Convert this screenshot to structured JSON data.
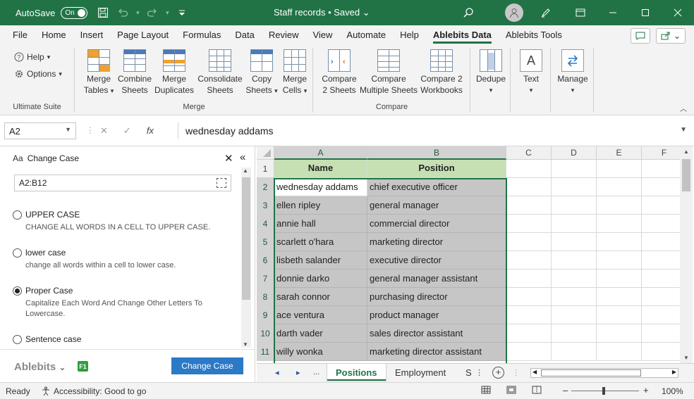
{
  "titlebar": {
    "autosave_label": "AutoSave",
    "autosave_state": "On",
    "title": "Staff records • Saved",
    "title_chevron": "⌄",
    "icons": [
      "save-icon",
      "undo-icon",
      "redo-icon",
      "customize-icon",
      "search-icon",
      "avatar",
      "pen-icon",
      "ribbon-display-icon",
      "minimize-icon",
      "maximize-icon",
      "close-icon"
    ]
  },
  "menu": {
    "tabs": [
      "File",
      "Home",
      "Insert",
      "Page Layout",
      "Formulas",
      "Data",
      "Review",
      "View",
      "Automate",
      "Help",
      "Ablebits Data",
      "Ablebits Tools"
    ],
    "active": "Ablebits Data",
    "share_arrow": "⌄"
  },
  "ribbon": {
    "ultimate_suite": {
      "label": "Ultimate Suite",
      "help": "Help",
      "options": "Options"
    },
    "merge": {
      "label": "Merge",
      "buttons": [
        {
          "line1": "Merge",
          "line2": "Tables"
        },
        {
          "line1": "Combine",
          "line2": "Sheets"
        },
        {
          "line1": "Merge",
          "line2": "Duplicates"
        },
        {
          "line1": "Consolidate",
          "line2": "Sheets"
        },
        {
          "line1": "Copy",
          "line2": "Sheets"
        },
        {
          "line1": "Merge",
          "line2": "Cells"
        }
      ]
    },
    "compare": {
      "label": "Compare",
      "buttons": [
        {
          "line1": "Compare",
          "line2": "2 Sheets"
        },
        {
          "line1": "Compare",
          "line2": "Multiple Sheets"
        },
        {
          "line1": "Compare 2",
          "line2": "Workbooks"
        }
      ]
    },
    "dedupe": {
      "label": "Dedupe"
    },
    "text": {
      "label": "Text",
      "glyph": "A"
    },
    "manage": {
      "label": "Manage"
    }
  },
  "formula_bar": {
    "name_box": "A2",
    "cancel": "✕",
    "enter": "✓",
    "fx": "fx",
    "value": "wednesday addams"
  },
  "pane": {
    "icon_glyph": "Aa",
    "title": "Change Case",
    "close": "✕",
    "collapse": "«",
    "range": "A2:B12",
    "options": [
      {
        "label": "UPPER CASE",
        "desc": "CHANGE ALL WORDS IN A CELL TO UPPER CASE.",
        "checked": false
      },
      {
        "label": "lower case",
        "desc": "change all words within a cell to lower case.",
        "checked": false
      },
      {
        "label": "Proper Case",
        "desc": "Capitalize Each Word And Change Other Letters To Lowercase.",
        "checked": true
      },
      {
        "label": "Sentence case",
        "desc": "",
        "checked": false
      }
    ],
    "brand": "Ablebits",
    "brand_chevron": "⌄",
    "f1": "F1",
    "primary_button": "Change Case"
  },
  "sheet": {
    "columns": [
      "A",
      "B",
      "C",
      "D",
      "E",
      "F"
    ],
    "rows": [
      "1",
      "2",
      "3",
      "4",
      "5",
      "6",
      "7",
      "8",
      "9",
      "10",
      "11"
    ],
    "headers": [
      "Name",
      "Position"
    ],
    "data": [
      [
        "wednesday addams",
        "chief executive officer"
      ],
      [
        "ellen ripley",
        "general manager"
      ],
      [
        "annie hall",
        "commercial director"
      ],
      [
        "scarlett o'hara",
        "marketing director"
      ],
      [
        "lisbeth salander",
        "executive director"
      ],
      [
        "donnie darko",
        "general manager assistant"
      ],
      [
        "sarah connor",
        "purchasing director"
      ],
      [
        "ace ventura",
        "product manager"
      ],
      [
        "darth vader",
        "sales director assistant"
      ],
      [
        "willy wonka",
        "marketing director assistant"
      ]
    ],
    "tabs": [
      "Positions",
      "Employment",
      "S"
    ],
    "active_tab": "Positions",
    "nav_prev": "◂",
    "nav_next": "▸",
    "nav_more": "...",
    "tab_more": "⋮",
    "add_sheet": "+"
  },
  "status": {
    "ready": "Ready",
    "accessibility": "Accessibility: Good to go",
    "zoom_minus": "–",
    "zoom_plus": "+",
    "zoom": "100%"
  },
  "colors": {
    "excel_green": "#217346",
    "header_fill": "#c6e0b4",
    "selection_fill": "#c6c6c6",
    "primary_button": "#2b79c7"
  }
}
